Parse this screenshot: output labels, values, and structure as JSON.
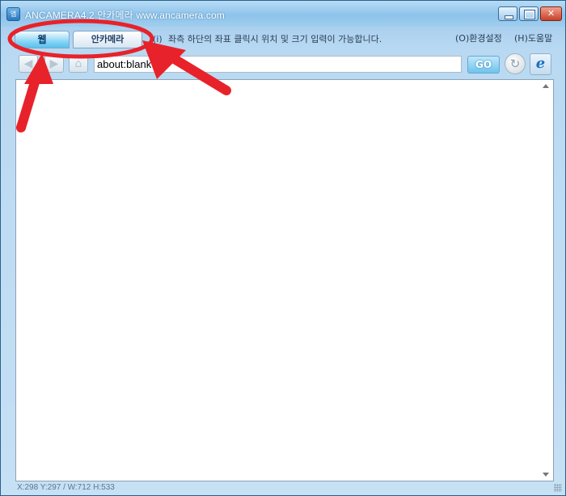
{
  "window": {
    "title": "ANCAMERA4.2 안카메라 www.ancamera.com",
    "app_icon": "앱",
    "controls": {
      "minimize_icon": "minimize-icon",
      "maximize_icon": "maximize-icon",
      "close_glyph": "✕"
    }
  },
  "tabs": [
    {
      "label": "웹",
      "active": true
    },
    {
      "label": "안카메라",
      "active": false
    }
  ],
  "hint_icon": "(i)",
  "hint": "좌측 하단의 좌표 클릭시 위치 및 크기 입력이 가능합니다.",
  "menu": {
    "settings": "(O)환경설정",
    "help": "(H)도움말"
  },
  "toolbar": {
    "address_value": "about:blank",
    "go_label": "GO",
    "back_icon": "back-arrow-icon",
    "forward_icon": "forward-arrow-icon",
    "home_icon": "home-icon",
    "refresh_icon": "refresh-icon",
    "ie_icon": "internet-explorer-icon"
  },
  "status": "X:298 Y:297 / W:712 H:533",
  "colors": {
    "accent": "#5cc0ee",
    "annotation": "#e8222a"
  }
}
